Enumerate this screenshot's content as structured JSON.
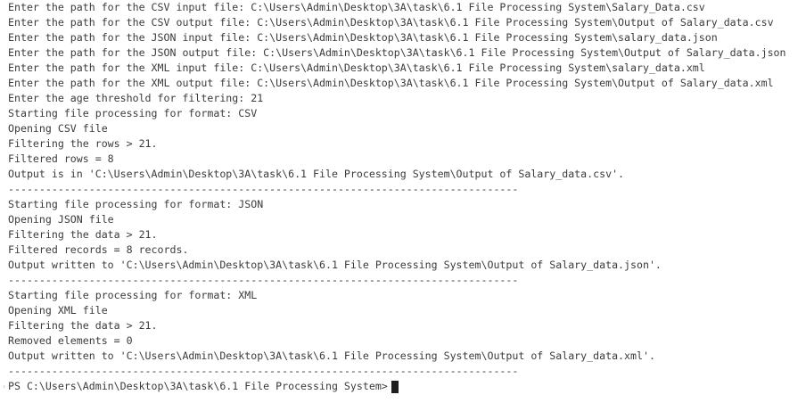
{
  "terminal": {
    "lines": [
      "Enter the path for the CSV input file: C:\\Users\\Admin\\Desktop\\3A\\task\\6.1 File Processing System\\Salary_Data.csv",
      "Enter the path for the CSV output file: C:\\Users\\Admin\\Desktop\\3A\\task\\6.1 File Processing System\\Output of Salary_data.csv",
      "Enter the path for the JSON input file: C:\\Users\\Admin\\Desktop\\3A\\task\\6.1 File Processing System\\salary_data.json",
      "Enter the path for the JSON output file: C:\\Users\\Admin\\Desktop\\3A\\task\\6.1 File Processing System\\Output of Salary_data.json",
      "Enter the path for the XML input file: C:\\Users\\Admin\\Desktop\\3A\\task\\6.1 File Processing System\\salary_data.xml",
      "Enter the path for the XML output file: C:\\Users\\Admin\\Desktop\\3A\\task\\6.1 File Processing System\\Output of Salary_data.xml",
      "Enter the age threshold for filtering: 21",
      "Starting file processing for format: CSV",
      "Opening CSV file",
      "Filtering the rows > 21.",
      "Filtered rows = 8",
      "Output is in 'C:\\Users\\Admin\\Desktop\\3A\\task\\6.1 File Processing System\\Output of Salary_data.csv'.",
      "----------------------------------------------------------------------------------",
      "Starting file processing for format: JSON",
      "Opening JSON file",
      "Filtering the data > 21.",
      "Filtered records = 8 records.",
      "Output written to 'C:\\Users\\Admin\\Desktop\\3A\\task\\6.1 File Processing System\\Output of Salary_data.json'.",
      "----------------------------------------------------------------------------------",
      "Starting file processing for format: XML",
      "Opening XML file",
      "Filtering the data > 21.",
      "Removed elements = 0",
      "Output written to 'C:\\Users\\Admin\\Desktop\\3A\\task\\6.1 File Processing System\\Output of Salary_data.xml'.",
      "----------------------------------------------------------------------------------"
    ],
    "prompt": "PS C:\\Users\\Admin\\Desktop\\3A\\task\\6.1 File Processing System>",
    "gutter_icon": "chevron-right-icon"
  }
}
